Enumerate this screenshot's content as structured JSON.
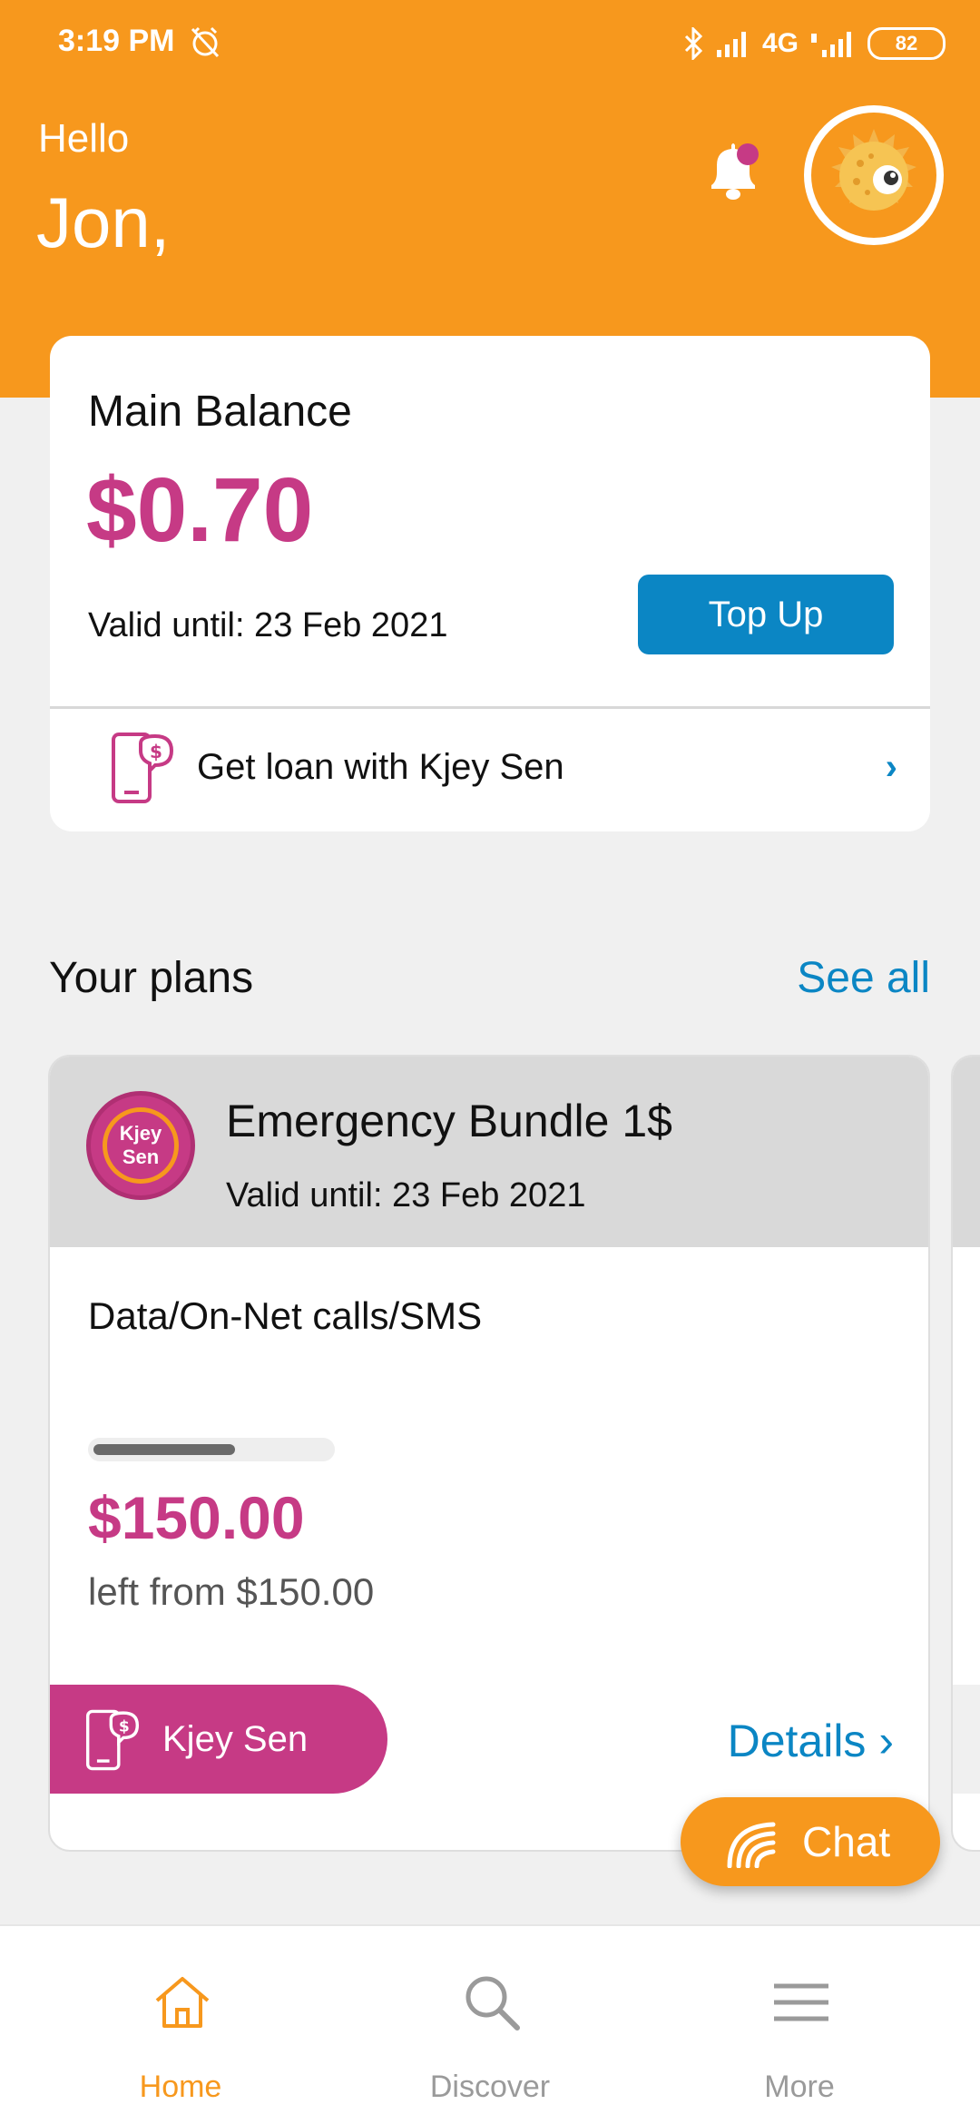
{
  "status_bar": {
    "time": "3:19 PM",
    "network": "4G",
    "battery": "82"
  },
  "greeting": {
    "hello": "Hello",
    "name": "Jon,"
  },
  "balance": {
    "title": "Main Balance",
    "amount": "$0.70",
    "valid_until": "Valid until: 23 Feb 2021",
    "top_up_label": "Top Up",
    "loan_label": "Get loan with Kjey Sen"
  },
  "plans": {
    "section_title": "Your plans",
    "see_all_label": "See all",
    "items": [
      {
        "logo_line1": "Kjey",
        "logo_line2": "Sen",
        "name": "Emergency Bundle 1$",
        "valid_until": "Valid until: 23 Feb 2021",
        "service": "Data/On-Net calls/SMS",
        "usage_fraction": 0.6,
        "amount_left": "$150.00",
        "left_from": "left from $150.00",
        "action_label": "Kjey Sen",
        "details_label": "Details"
      }
    ]
  },
  "chat": {
    "label": "Chat"
  },
  "nav": {
    "items": [
      {
        "label": "Home",
        "icon": "home-icon",
        "active": true
      },
      {
        "label": "Discover",
        "icon": "search-icon",
        "active": false
      },
      {
        "label": "More",
        "icon": "menu-icon",
        "active": false
      }
    ]
  },
  "colors": {
    "brand_orange": "#f7981d",
    "accent_magenta": "#c63a85",
    "link_blue": "#0b86c4"
  }
}
